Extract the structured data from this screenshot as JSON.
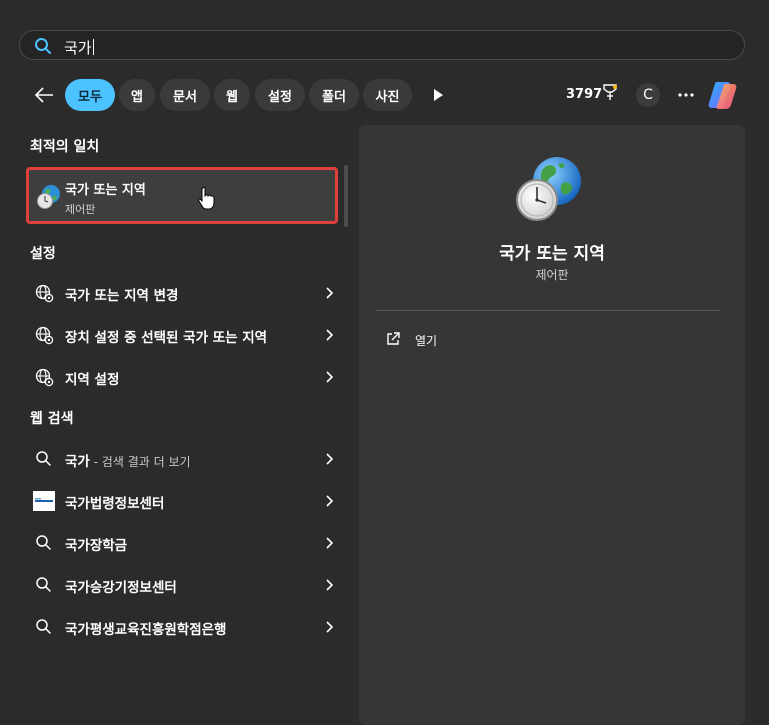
{
  "search": {
    "query": "국가",
    "icon": "search-icon"
  },
  "filters": [
    {
      "label": "모두",
      "active": true
    },
    {
      "label": "앱",
      "active": false
    },
    {
      "label": "문서",
      "active": false
    },
    {
      "label": "웹",
      "active": false
    },
    {
      "label": "설정",
      "active": false
    },
    {
      "label": "폴더",
      "active": false
    },
    {
      "label": "사진",
      "active": false
    }
  ],
  "toolbar": {
    "points": "3797",
    "avatar_initial": "C"
  },
  "best_match": {
    "section_title": "최적의 일치",
    "title": "국가 또는 지역",
    "subtitle": "제어판",
    "icon": "globe-clock-icon"
  },
  "settings": {
    "section_title": "설정",
    "items": [
      {
        "label": "국가 또는 지역 변경",
        "icon": "globe-settings-icon"
      },
      {
        "label": "장치 설정 중 선택된 국가 또는 지역",
        "icon": "globe-settings-icon"
      },
      {
        "label": "지역 설정",
        "icon": "globe-settings-icon"
      }
    ]
  },
  "web_search": {
    "section_title": "웹 검색",
    "items": [
      {
        "label": "국가",
        "suffix": " - 검색 결과 더 보기",
        "icon": "search-icon"
      },
      {
        "label": "국가법령정보센터",
        "suffix": "",
        "icon": "site-favicon"
      },
      {
        "label": "국가장학금",
        "suffix": "",
        "icon": "search-icon"
      },
      {
        "label": "국가승강기정보센터",
        "suffix": "",
        "icon": "search-icon"
      },
      {
        "label": "국가평생교육진흥원학점은행",
        "suffix": "",
        "icon": "search-icon"
      }
    ]
  },
  "preview": {
    "title": "국가 또는 지역",
    "subtitle": "제어판",
    "open_label": "열기"
  },
  "colors": {
    "accent": "#4cc2ff",
    "highlight_border": "#e0403b",
    "background": "#2b2b2b",
    "panel": "#363636"
  }
}
